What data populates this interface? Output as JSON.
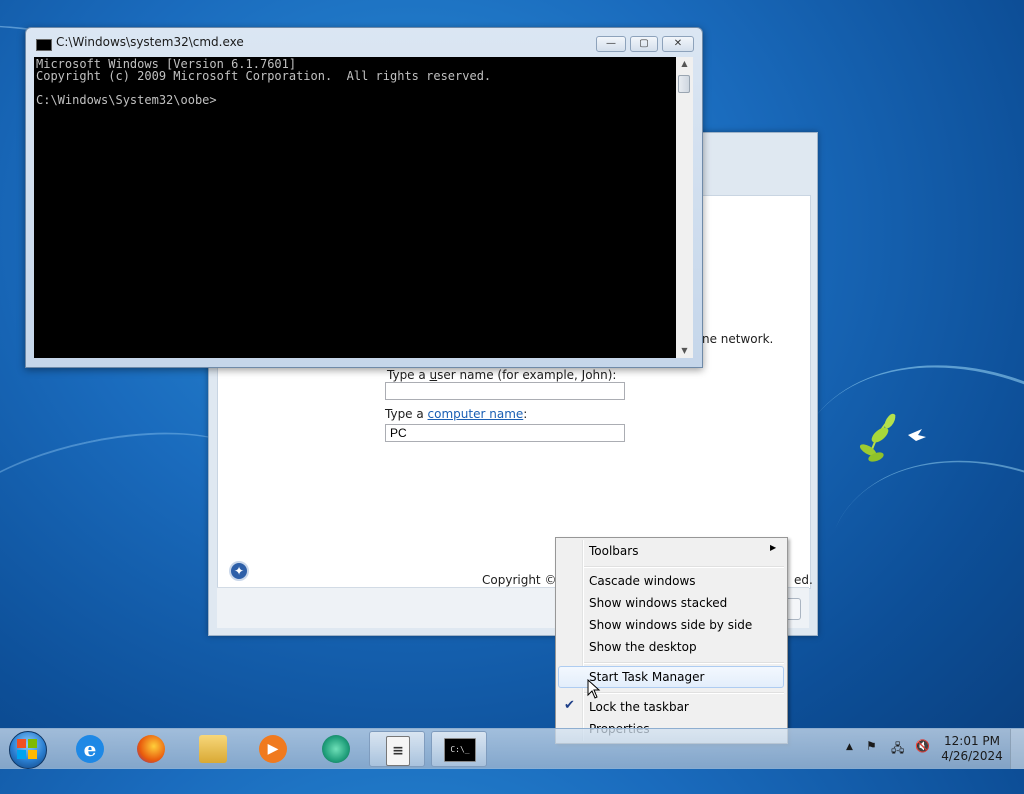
{
  "cmd_window": {
    "title": "C:\\Windows\\system32\\cmd.exe",
    "console_text": "Microsoft Windows [Version 6.1.7601]\nCopyright (c) 2009 Microsoft Corporation.  All rights reserved.\n\nC:\\Windows\\System32\\oobe>",
    "buttons": {
      "minimize": "—",
      "maximize": "▢",
      "close": "✕"
    }
  },
  "oobe_window": {
    "network_text_fragment": "ne network.",
    "username_label_prefix": "Type a ",
    "username_label_u": "u",
    "username_label_rest": "ser name (for example, John):",
    "username_value": "",
    "computer_label_prefix": "Type a ",
    "computer_link": "computer name",
    "computer_label_suffix": ":",
    "computer_value": "PC",
    "copyright_fragment": "Copyright © 2",
    "reserved_fragment": "ed."
  },
  "context_menu": {
    "items": [
      {
        "label": "Toolbars",
        "submenu": true
      },
      {
        "label": "Cascade windows"
      },
      {
        "label": "Show windows stacked"
      },
      {
        "label": "Show windows side by side"
      },
      {
        "label": "Show the desktop"
      },
      {
        "label": "Start Task Manager",
        "highlighted": true
      },
      {
        "label": "Lock the taskbar",
        "checked": true
      },
      {
        "label": "Properties"
      }
    ]
  },
  "taskbar": {
    "pinned": [
      {
        "name": "internet-explorer",
        "glyph": "e",
        "color": "#1e88e5"
      },
      {
        "name": "firefox",
        "glyph": "🦊",
        "color": "#e8590c"
      },
      {
        "name": "file-explorer",
        "glyph": "📁",
        "color": "#e6b94a"
      },
      {
        "name": "media-player",
        "glyph": "▶",
        "color": "#f07a1e"
      },
      {
        "name": "green-app",
        "glyph": "●",
        "color": "#1f9e7a"
      },
      {
        "name": "notepad-doc",
        "glyph": "≡",
        "color": "#9aa4ae"
      },
      {
        "name": "cmd",
        "glyph": "C:\\_",
        "color": "#000000"
      }
    ],
    "clock_time": "12:01 PM",
    "clock_date": "4/26/2024",
    "tray_chevron": "▲"
  }
}
